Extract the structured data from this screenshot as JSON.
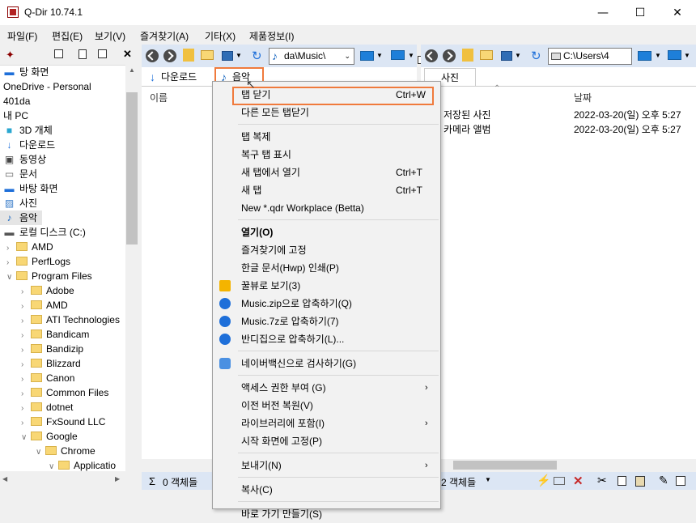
{
  "window": {
    "title": "Q-Dir 10.74.1"
  },
  "menubar": {
    "items": [
      "파일(F)",
      "편집(E)",
      "보기(V)",
      "즐겨찾기(A)",
      "기타(X)",
      "제품정보(I)"
    ],
    "music_label": "음악"
  },
  "left_tree": {
    "items": [
      {
        "label": "탕 화면",
        "indent": 0,
        "type": "desktop"
      },
      {
        "label": "OneDrive - Personal",
        "indent": 0,
        "type": "none"
      },
      {
        "label": "401da",
        "indent": 0,
        "type": "none"
      },
      {
        "label": "내 PC",
        "indent": 0,
        "type": "none"
      },
      {
        "label": "3D 개체",
        "indent": 0,
        "type": "cube"
      },
      {
        "label": "다운로드",
        "indent": 0,
        "type": "download"
      },
      {
        "label": "동영상",
        "indent": 0,
        "type": "video"
      },
      {
        "label": "문서",
        "indent": 0,
        "type": "doc"
      },
      {
        "label": "바탕 화면",
        "indent": 0,
        "type": "desktop"
      },
      {
        "label": "사진",
        "indent": 0,
        "type": "photo"
      },
      {
        "label": "음악",
        "indent": 0,
        "type": "music"
      },
      {
        "label": "로컬 디스크 (C:)",
        "indent": 0,
        "type": "drive"
      },
      {
        "label": "AMD",
        "indent": 1,
        "type": "folder"
      },
      {
        "label": "PerfLogs",
        "indent": 1,
        "type": "folder"
      },
      {
        "label": "Program Files",
        "indent": 1,
        "type": "folder"
      },
      {
        "label": "Adobe",
        "indent": 2,
        "type": "folder"
      },
      {
        "label": "AMD",
        "indent": 2,
        "type": "folder"
      },
      {
        "label": "ATI Technologies",
        "indent": 2,
        "type": "folder"
      },
      {
        "label": "Bandicam",
        "indent": 2,
        "type": "folder"
      },
      {
        "label": "Bandizip",
        "indent": 2,
        "type": "folder"
      },
      {
        "label": "Blizzard",
        "indent": 2,
        "type": "folder"
      },
      {
        "label": "Canon",
        "indent": 2,
        "type": "folder"
      },
      {
        "label": "Common Files",
        "indent": 2,
        "type": "folder"
      },
      {
        "label": "dotnet",
        "indent": 2,
        "type": "folder"
      },
      {
        "label": "FxSound LLC",
        "indent": 2,
        "type": "folder"
      },
      {
        "label": "Google",
        "indent": 2,
        "type": "folder"
      },
      {
        "label": "Chrome",
        "indent": 3,
        "type": "folder"
      },
      {
        "label": "Applicatio",
        "indent": 4,
        "type": "folder"
      }
    ]
  },
  "pane_left": {
    "address": "da\\Music\\",
    "tabs": [
      "다운로드",
      "음악"
    ],
    "col_name": "이름",
    "status": "0 객체들"
  },
  "pane_right": {
    "address": "C:\\Users\\4",
    "tab": "사진",
    "col_date": "날짜",
    "rows": [
      {
        "name": "저장된 사진",
        "date": "2022-03-20(일) 오후 5:27"
      },
      {
        "name": "카메라 앨범",
        "date": "2022-03-20(일) 오후 5:27"
      }
    ],
    "status": "2 객체들"
  },
  "context_menu": {
    "items": [
      {
        "label": "탭 닫기",
        "shortcut": "Ctrl+W"
      },
      {
        "label": "다른 모든 탭닫기"
      },
      {
        "sep": true
      },
      {
        "label": "탭 복제"
      },
      {
        "label": "복구 탭 표시"
      },
      {
        "label": "새 탭에서 열기",
        "shortcut": "Ctrl+T"
      },
      {
        "label": "새 탭",
        "shortcut": "Ctrl+T"
      },
      {
        "label": "New *.qdr Workplace (Betta)"
      },
      {
        "sep": true
      },
      {
        "label": "열기(O)",
        "bold": true
      },
      {
        "label": "즐겨찾기에 고정"
      },
      {
        "label": "한글 문서(Hwp) 인쇄(P)"
      },
      {
        "label": "꿀뷰로 보기(3)",
        "icon": "honeyview-icon"
      },
      {
        "label": "Music.zip으로 압축하기(Q)",
        "icon": "bandizip-icon"
      },
      {
        "label": "Music.7z로 압축하기(7)",
        "icon": "bandizip-icon"
      },
      {
        "label": "반디집으로 압축하기(L)...",
        "icon": "bandizip-icon"
      },
      {
        "sep": true
      },
      {
        "label": "네이버백신으로 검사하기(G)",
        "icon": "shield-icon"
      },
      {
        "sep": true
      },
      {
        "label": "액세스 권한 부여 (G)",
        "submenu": true
      },
      {
        "label": "이전 버전 복원(V)"
      },
      {
        "label": "라이브러리에 포함(I)",
        "submenu": true
      },
      {
        "label": "시작 화면에 고정(P)"
      },
      {
        "sep": true
      },
      {
        "label": "보내기(N)",
        "submenu": true
      },
      {
        "sep": true
      },
      {
        "label": "복사(C)"
      },
      {
        "sep": true
      },
      {
        "label": "바로 가기 만들기(S)"
      }
    ]
  }
}
